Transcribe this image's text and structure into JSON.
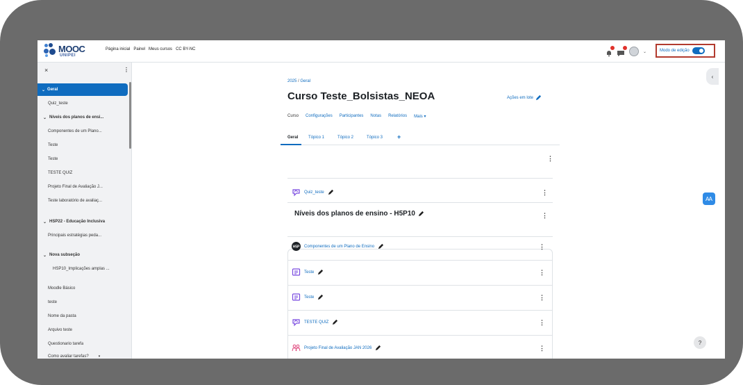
{
  "header": {
    "logo_text": "MOOC",
    "logo_sub": "UNIPEI",
    "nav": [
      "Página inicial",
      "Painel",
      "Meus cursos",
      "CC BY-NC"
    ],
    "edit_mode_label": "Modo de edição"
  },
  "sidebar": {
    "close_glyph": "×",
    "menu_glyph": "⋮",
    "items": [
      {
        "label": "Geral",
        "chevron": "⌄"
      },
      {
        "label": "Quiz_teste"
      },
      {
        "label": "Níveis dos planos de ensi...",
        "chevron": "⌄"
      },
      {
        "label": "Componentes de um Plano..."
      },
      {
        "label": "Teste"
      },
      {
        "label": "Teste"
      },
      {
        "label": "TESTE QUIZ"
      },
      {
        "label": "Projeto Final de Avaliação J..."
      },
      {
        "label": "Teste laboratório de avaliaç..."
      },
      {
        "label": "HSP22 - Educação Inclusiva",
        "chevron": "⌄"
      },
      {
        "label": "Principais estratégias peda..."
      },
      {
        "label": "Nova subseção",
        "chevron": "⌄"
      },
      {
        "label": "HSP10_Implicações amplas ..."
      },
      {
        "label": "Moodle Básico"
      },
      {
        "label": "teste"
      },
      {
        "label": "Nome da pasta"
      },
      {
        "label": "Arquivo teste"
      },
      {
        "label": "Questionario tarefa"
      },
      {
        "label": "Como avaliar tarefas?"
      }
    ]
  },
  "main": {
    "breadcrumb": [
      "2025",
      "/",
      "Geral"
    ],
    "title": "Curso Teste_Bolsistas_NEOA",
    "bulk_actions": "Ações em lote",
    "course_tabs": [
      "Curso",
      "Configurações",
      "Participantes",
      "Notas",
      "Relatórios",
      "Mais ▾"
    ],
    "topic_tabs": [
      "Geral",
      "Tópico 1",
      "Tópico 2",
      "Tópico 3",
      "+"
    ],
    "activities": [
      {
        "label": "Quiz_teste",
        "icon": "quiz-icon"
      }
    ],
    "section": {
      "title": "Níveis dos planos de ensino - H5P10",
      "activities": [
        {
          "label": "Componentes de um Plano de Ensino",
          "icon": "h5p-icon"
        },
        {
          "label": "Teste",
          "icon": "page-icon"
        },
        {
          "label": "Teste",
          "icon": "page-icon"
        },
        {
          "label": "TESTE QUIZ",
          "icon": "quiz-icon"
        },
        {
          "label": "Projeto Final de Avaliação JAN 2026",
          "icon": "workshop-icon"
        }
      ]
    }
  },
  "colors": {
    "accent": "#0f6cbf",
    "highlight_border": "#b23a2e",
    "frame": "#6b6b6b"
  },
  "floating": {
    "collapse_glyph": "‹",
    "help_glyph": "?",
    "access_glyph": "Ꜳ"
  }
}
